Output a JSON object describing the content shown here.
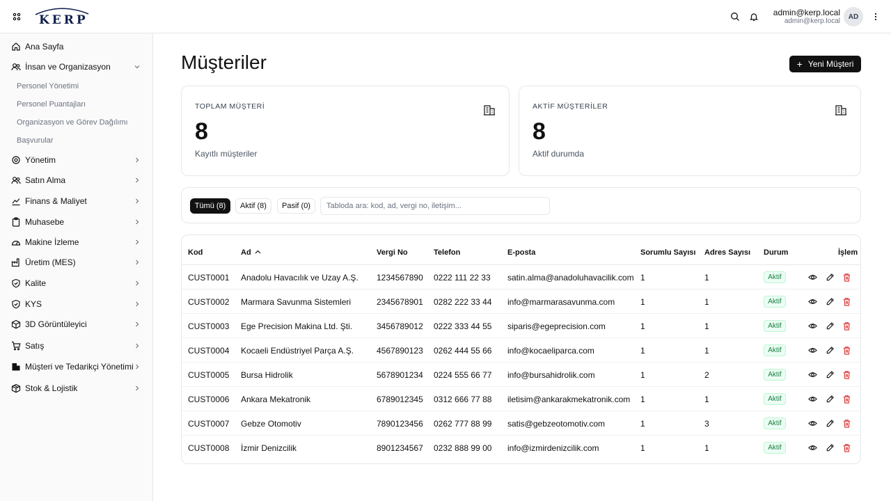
{
  "header": {
    "logo_text": "KERP",
    "user_name": "admin@kerp.local",
    "user_email": "admin@kerp.local",
    "avatar_initials": "AD"
  },
  "sidebar": {
    "items": [
      {
        "label": "Ana Sayfa",
        "icon": "home-icon"
      },
      {
        "label": "İnsan ve Organizasyon",
        "icon": "users-icon",
        "expanded": true,
        "children": [
          "Personel Yönetimi",
          "Personel Puantajları",
          "Organizasyon ve Görev Dağılımı",
          "Başvurular"
        ]
      },
      {
        "label": "Yönetim",
        "icon": "settings-icon"
      },
      {
        "label": "Satın Alma",
        "icon": "users-icon"
      },
      {
        "label": "Finans & Maliyet",
        "icon": "trending-icon"
      },
      {
        "label": "Muhasebe",
        "icon": "clipboard-icon"
      },
      {
        "label": "Makine İzleme",
        "icon": "gauge-icon"
      },
      {
        "label": "Üretim (MES)",
        "icon": "factory-icon"
      },
      {
        "label": "Kalite",
        "icon": "shield-icon"
      },
      {
        "label": "KYS",
        "icon": "shield-icon"
      },
      {
        "label": "3D Görüntüleyici",
        "icon": "cube-icon"
      },
      {
        "label": "Satış",
        "icon": "cart-icon"
      },
      {
        "label": "Müşteri ve Tedarikçi Yönetimi",
        "icon": "building-icon"
      },
      {
        "label": "Stok & Lojistik",
        "icon": "package-icon"
      }
    ]
  },
  "page": {
    "title": "Müşteriler",
    "new_button": "Yeni Müşteri"
  },
  "stats": [
    {
      "label": "TOPLAM MÜŞTERİ",
      "value": "8",
      "sub": "Kayıtlı müşteriler",
      "icon": "building-icon"
    },
    {
      "label": "AKTİF MÜŞTERİLER",
      "value": "8",
      "sub": "Aktif durumda",
      "icon": "building-icon"
    }
  ],
  "filters": {
    "chips": [
      "Tümü (8)",
      "Aktif (8)",
      "Pasif (0)"
    ],
    "active_chip": "Tümü (8)",
    "search_placeholder": "Tabloda ara: kod, ad, vergi no, iletişim..."
  },
  "table": {
    "columns": [
      "Kod",
      "Ad",
      "Vergi No",
      "Telefon",
      "E-posta",
      "Sorumlu Sayısı",
      "Adres Sayısı",
      "Durum",
      "İşlem"
    ],
    "sorted_column": "Ad",
    "rows": [
      [
        "CUST0001",
        "Anadolu Havacılık ve Uzay A.Ş.",
        "1234567890",
        "0222 111 22 33",
        "satin.alma@anadoluhavacilik.com",
        "1",
        "1",
        "Aktif"
      ],
      [
        "CUST0002",
        "Marmara Savunma Sistemleri",
        "2345678901",
        "0282 222 33 44",
        "info@marmarasavunma.com",
        "1",
        "1",
        "Aktif"
      ],
      [
        "CUST0003",
        "Ege Precision Makina Ltd. Şti.",
        "3456789012",
        "0222 333 44 55",
        "siparis@egeprecision.com",
        "1",
        "1",
        "Aktif"
      ],
      [
        "CUST0004",
        "Kocaeli Endüstriyel Parça A.Ş.",
        "4567890123",
        "0262 444 55 66",
        "info@kocaeliparca.com",
        "1",
        "1",
        "Aktif"
      ],
      [
        "CUST0005",
        "Bursa Hidrolik",
        "5678901234",
        "0224 555 66 77",
        "info@bursahidrolik.com",
        "1",
        "2",
        "Aktif"
      ],
      [
        "CUST0006",
        "Ankara Mekatronik",
        "6789012345",
        "0312 666 77 88",
        "iletisim@ankarakmekatronik.com",
        "1",
        "1",
        "Aktif"
      ],
      [
        "CUST0007",
        "Gebze Otomotiv",
        "7890123456",
        "0262 777 88 99",
        "satis@gebzeotomotiv.com",
        "1",
        "3",
        "Aktif"
      ],
      [
        "CUST0008",
        "İzmir Denizcilik",
        "8901234567",
        "0232 888 99 00",
        "info@izmirdenizcilik.com",
        "1",
        "1",
        "Aktif"
      ]
    ]
  },
  "colors": {
    "primary": "#111111",
    "active_badge_bg": "#ecfdf5",
    "active_badge_text": "#15803d",
    "delete": "#dc2626",
    "logo": "#0f1e4a"
  }
}
